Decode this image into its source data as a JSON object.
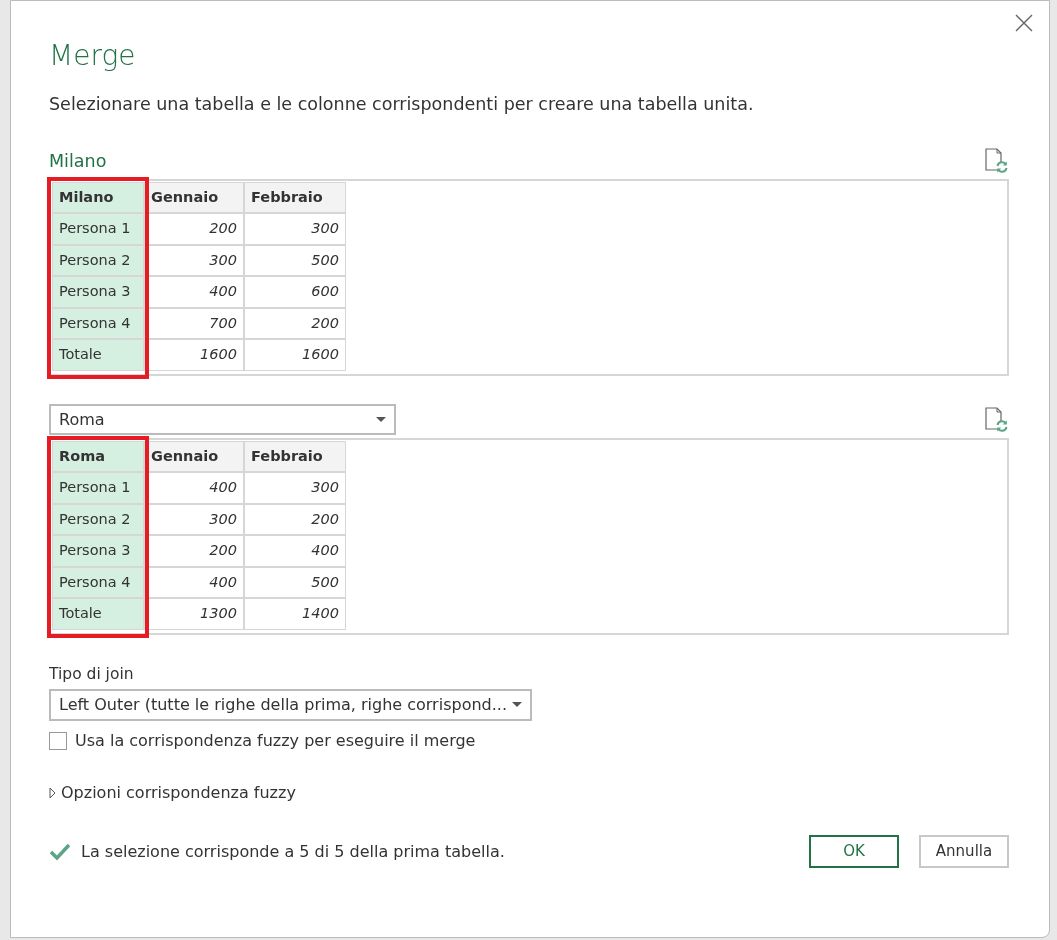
{
  "dialog": {
    "title": "Merge",
    "description": "Selezionare una tabella e le colonne corrispondenti per creare una tabella unita."
  },
  "tables": [
    {
      "kind": "label",
      "source": "Milano",
      "columns": [
        {
          "header": "Milano",
          "kind": "text",
          "selected": true
        },
        {
          "header": "Gennaio",
          "kind": "number",
          "selected": false
        },
        {
          "header": "Febbraio",
          "kind": "number",
          "selected": false
        }
      ],
      "rows": [
        [
          "Persona 1",
          "200",
          "300"
        ],
        [
          "Persona 2",
          "300",
          "500"
        ],
        [
          "Persona 3",
          "400",
          "600"
        ],
        [
          "Persona 4",
          "700",
          "200"
        ],
        [
          "Totale",
          "1600",
          "1600"
        ]
      ]
    },
    {
      "kind": "dropdown",
      "source": "Roma",
      "columns": [
        {
          "header": "Roma",
          "kind": "text",
          "selected": true
        },
        {
          "header": "Gennaio",
          "kind": "number",
          "selected": false
        },
        {
          "header": "Febbraio",
          "kind": "number",
          "selected": false
        }
      ],
      "rows": [
        [
          "Persona 1",
          "400",
          "300"
        ],
        [
          "Persona 2",
          "300",
          "200"
        ],
        [
          "Persona 3",
          "200",
          "400"
        ],
        [
          "Persona 4",
          "400",
          "500"
        ],
        [
          "Totale",
          "1300",
          "1400"
        ]
      ]
    }
  ],
  "join": {
    "label": "Tipo di join",
    "value": "Left Outer (tutte le righe della prima, righe corrispond..."
  },
  "fuzzy": {
    "label": "Usa la corrispondenza fuzzy per eseguire il merge",
    "checked": false
  },
  "fuzzy_options": {
    "label": "Opzioni corrispondenza fuzzy",
    "expanded": false
  },
  "status": {
    "text": "La selezione corrisponde a 5 di 5 della prima tabella.",
    "ok": true
  },
  "buttons": [
    {
      "label": "OK",
      "primary": true
    },
    {
      "label": "Annulla",
      "primary": false
    }
  ]
}
